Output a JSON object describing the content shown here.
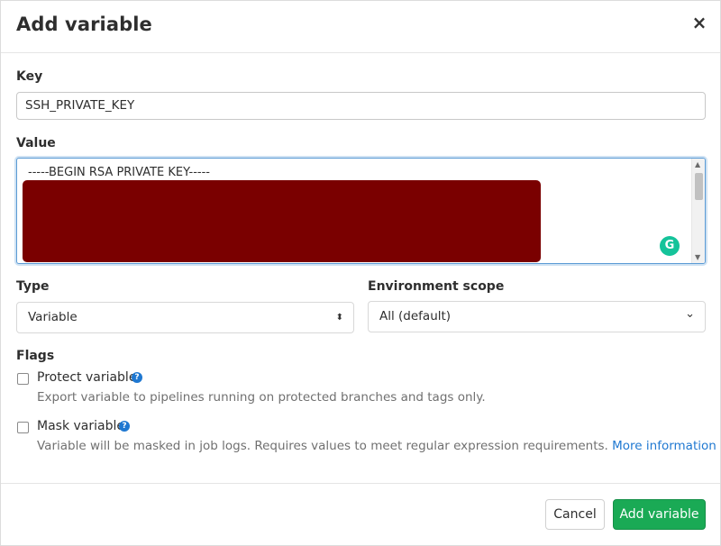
{
  "modal": {
    "title": "Add variable",
    "close_icon": "close-icon",
    "close_glyph": "×"
  },
  "form": {
    "key": {
      "label": "Key",
      "value": "SSH_PRIVATE_KEY"
    },
    "value": {
      "label": "Value",
      "first_line": "-----BEGIN RSA PRIVATE KEY-----",
      "redaction_color": "#7a0000"
    },
    "type": {
      "label": "Type",
      "selected": "Variable",
      "arrow_glyph": "⬍"
    },
    "environment_scope": {
      "label": "Environment scope",
      "selected": "All (default)",
      "arrow_glyph": "⌄"
    },
    "flags": {
      "label": "Flags",
      "protect": {
        "label": "Protect variable",
        "checked": false,
        "description": "Export variable to pipelines running on protected branches and tags only.",
        "help_glyph": "?"
      },
      "mask": {
        "label": "Mask variable",
        "checked": false,
        "description": "Variable will be masked in job logs. Requires values to meet regular expression requirements.",
        "link_text": "More information",
        "help_glyph": "?"
      }
    }
  },
  "grammarly": {
    "glyph": "G",
    "color": "#15c39a"
  },
  "footer": {
    "cancel_label": "Cancel",
    "submit_label": "Add variable",
    "submit_color": "#1aaa55"
  }
}
